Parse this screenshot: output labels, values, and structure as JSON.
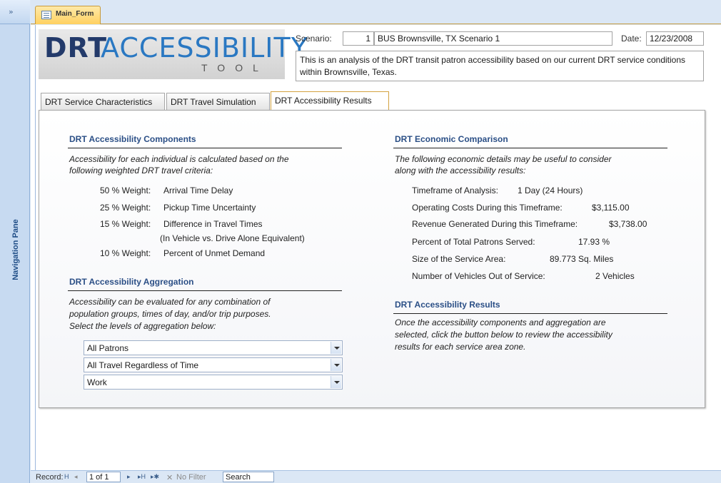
{
  "nav": {
    "toggle_glyph": "»",
    "pane_label": "Navigation Pane"
  },
  "doc_tab": {
    "label": "Main_Form"
  },
  "logo": {
    "part1": "DRT",
    "part2": "ACCESSIBILITY",
    "part3": "TOOL"
  },
  "scenario": {
    "label": "Scenario:",
    "number": "1",
    "name": "BUS Brownsville, TX Scenario 1"
  },
  "date": {
    "label": "Date:",
    "value": "12/23/2008"
  },
  "description": "This is an analysis of the DRT transit patron accessibility based on our current DRT service conditions within Brownsville, Texas.",
  "tabs": [
    {
      "label": "DRT Service Characteristics"
    },
    {
      "label": "DRT Travel Simulation"
    },
    {
      "label": "DRT Accessibility Results"
    }
  ],
  "components": {
    "title": "DRT Accessibility Components",
    "intro_line1": "Accessibility for each individual is calculated based on the",
    "intro_line2": "following weighted DRT travel criteria:",
    "weights": [
      {
        "weight": "50 % Weight:",
        "criterion": "Arrival Time Delay"
      },
      {
        "weight": "25 % Weight:",
        "criterion": "Pickup Time Uncertainty"
      },
      {
        "weight": "15 % Weight:",
        "criterion": "Difference in Travel Times"
      },
      {
        "weight": "10 % Weight:",
        "criterion": "Percent of Unmet Demand"
      }
    ],
    "note": "(In Vehicle vs. Drive Alone Equivalent)"
  },
  "aggregation": {
    "title": "DRT Accessibility Aggregation",
    "line1": "Accessibility can be evaluated for any combination of",
    "line2": "population groups, times of day, and/or trip purposes.",
    "line3": "Select the levels of aggregation below:",
    "selects": [
      "All Patrons",
      "All Travel Regardless of Time",
      "Work"
    ]
  },
  "economic": {
    "title": "DRT Economic Comparison",
    "line1": "The following economic details may be useful to consider",
    "line2": "along with the accessibility results:",
    "rows": [
      {
        "label": "Timeframe of Analysis:",
        "value": "1 Day (24 Hours)"
      },
      {
        "label": "Operating Costs During this Timeframe:",
        "value": "$3,115.00"
      },
      {
        "label": "Revenue Generated During this Timeframe:",
        "value": "$3,738.00"
      },
      {
        "label": "Percent of Total Patrons Served:",
        "value": "17.93  %"
      },
      {
        "label": "Size of the Service Area:",
        "value": "89.773  Sq. Miles"
      },
      {
        "label": "Number of Vehicles Out of Service:",
        "value": "2  Vehicles"
      }
    ]
  },
  "results": {
    "title": "DRT Accessibility Results",
    "line1": "Once the accessibility components and aggregation are",
    "line2": "selected, click the button below to review the accessibility",
    "line3": "results for each service area zone."
  },
  "record_bar": {
    "label": "Record:",
    "first": "H",
    "prev": "◂",
    "position": "1 of 1",
    "next": "▸",
    "last": "▸H",
    "new": "▸✱",
    "filter": "No Filter",
    "search": "Search"
  }
}
